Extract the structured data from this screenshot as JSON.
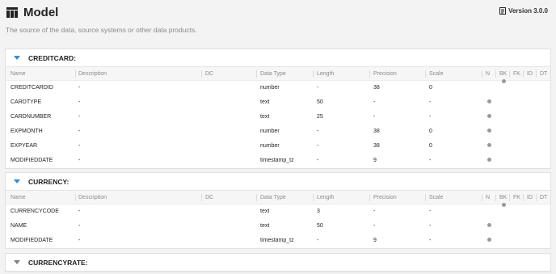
{
  "header": {
    "title": "Model",
    "subtitle": "The source of the data, source systems or other data products.",
    "version": "Version 3.0.0",
    "title_icon": "table-icon",
    "version_icon": "document-icon"
  },
  "columns": [
    "Name",
    "Description",
    "DC",
    "Data Type",
    "Length",
    "Precision",
    "Scale",
    "N",
    "BK",
    "FK",
    "ID",
    "DT"
  ],
  "tables": [
    {
      "title": "CREDITCARD:",
      "expanded": true,
      "rows": [
        {
          "name": "CREDITCARDID",
          "description": "-",
          "dc": "",
          "data_type": "number",
          "length": "-",
          "precision": "38",
          "scale": "0",
          "n": false,
          "bk": true
        },
        {
          "name": "CARDTYPE",
          "description": "-",
          "dc": "",
          "data_type": "text",
          "length": "50",
          "precision": "-",
          "scale": "-",
          "n": true,
          "bk": false
        },
        {
          "name": "CARDNUMBER",
          "description": "-",
          "dc": "",
          "data_type": "text",
          "length": "25",
          "precision": "-",
          "scale": "-",
          "n": true,
          "bk": false
        },
        {
          "name": "EXPMONTH",
          "description": "-",
          "dc": "",
          "data_type": "number",
          "length": "-",
          "precision": "38",
          "scale": "0",
          "n": true,
          "bk": false
        },
        {
          "name": "EXPYEAR",
          "description": "-",
          "dc": "",
          "data_type": "number",
          "length": "-",
          "precision": "38",
          "scale": "0",
          "n": true,
          "bk": false
        },
        {
          "name": "MODIFIEDDATE",
          "description": "-",
          "dc": "",
          "data_type": "timestamp_tz",
          "length": "-",
          "precision": "9",
          "scale": "-",
          "n": true,
          "bk": false
        }
      ]
    },
    {
      "title": "CURRENCY:",
      "expanded": true,
      "rows": [
        {
          "name": "CURRENCYCODE",
          "description": "-",
          "dc": "",
          "data_type": "text",
          "length": "3",
          "precision": "-",
          "scale": "-",
          "n": false,
          "bk": true
        },
        {
          "name": "NAME",
          "description": "-",
          "dc": "",
          "data_type": "text",
          "length": "50",
          "precision": "-",
          "scale": "-",
          "n": true,
          "bk": false
        },
        {
          "name": "MODIFIEDDATE",
          "description": "-",
          "dc": "",
          "data_type": "timestamp_tz",
          "length": "-",
          "precision": "9",
          "scale": "-",
          "n": true,
          "bk": false
        }
      ]
    },
    {
      "title": "CURRENCYRATE:",
      "expanded": false,
      "rows": []
    }
  ],
  "colors": {
    "accent": "#2d8ed6",
    "dot": "#9a9a9a"
  }
}
